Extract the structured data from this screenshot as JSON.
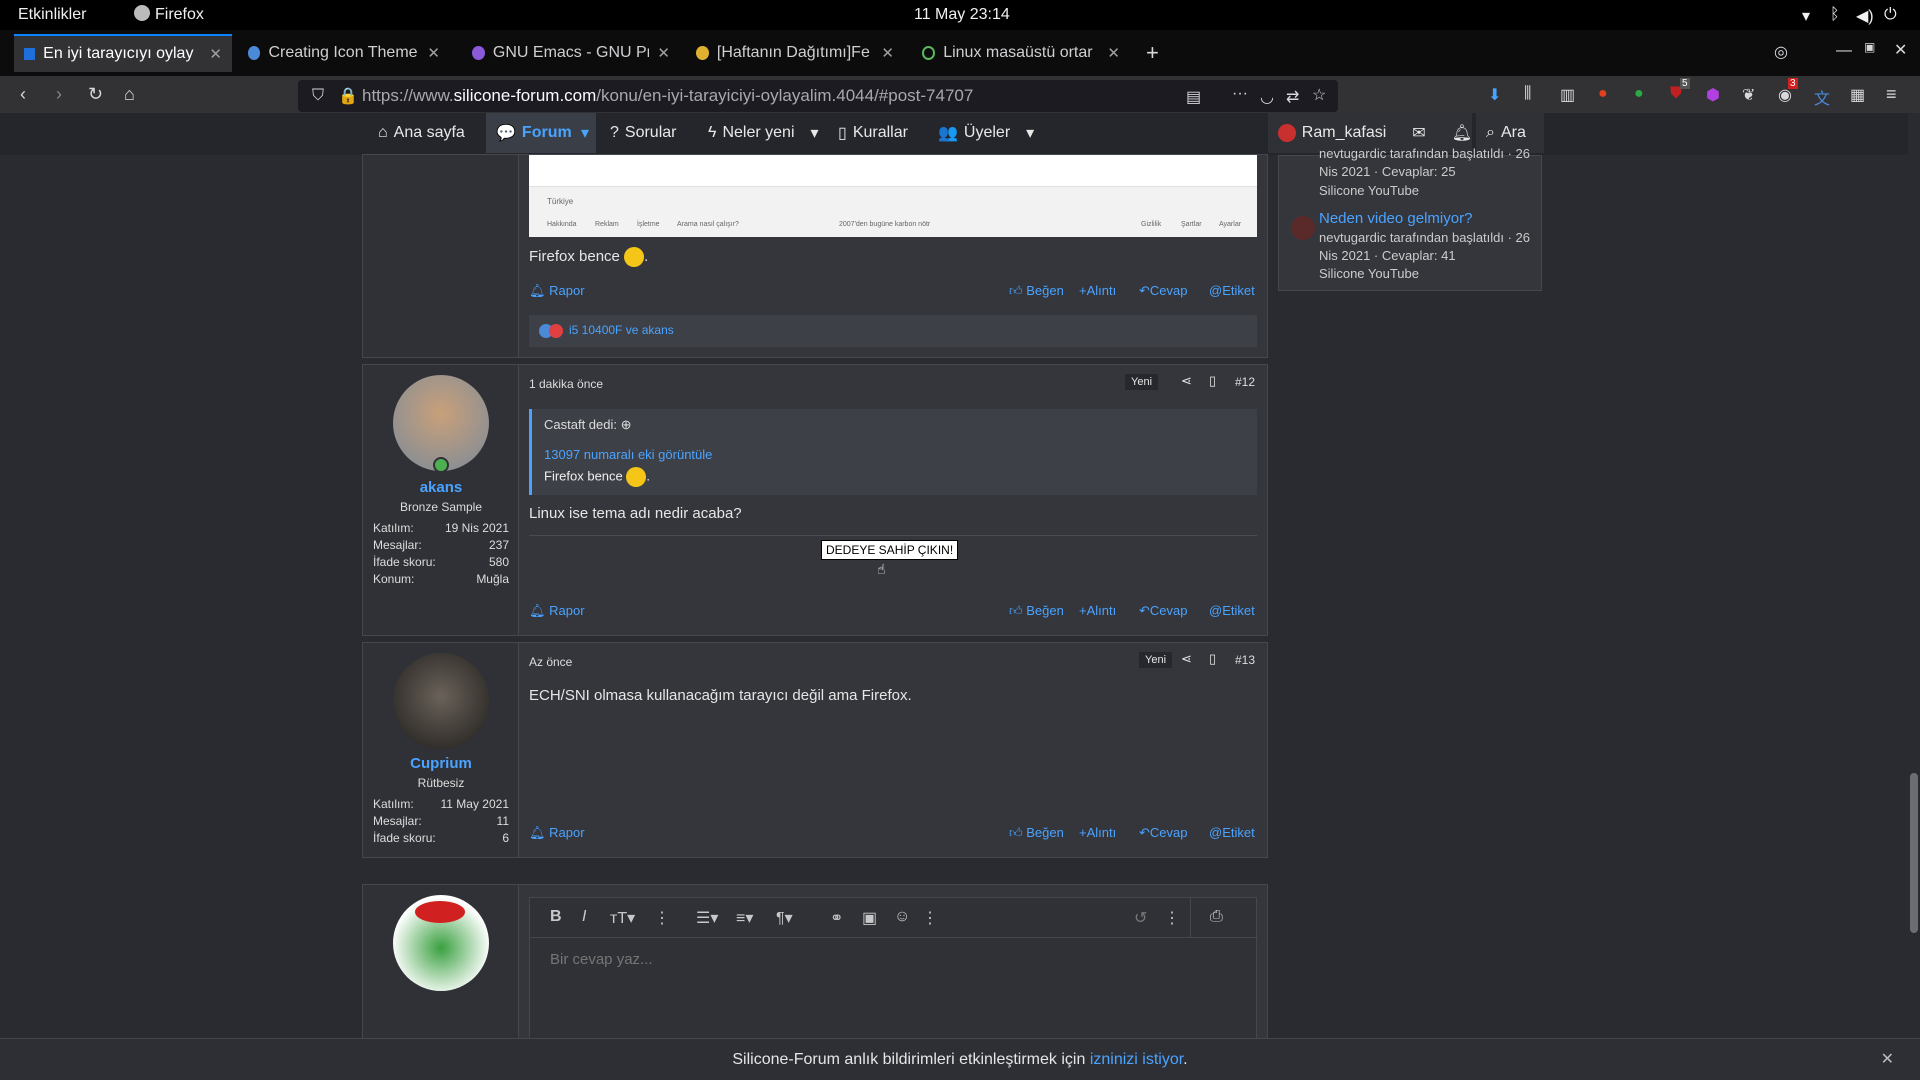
{
  "gnome": {
    "activities": "Etkinlikler",
    "app": "Firefox",
    "clock": "11 May 23:14"
  },
  "tabs": [
    {
      "title": "En iyi tarayıcıyı oylay"
    },
    {
      "title": "Creating Icon Theme"
    },
    {
      "title": "GNU Emacs - GNU Pr"
    },
    {
      "title": "[Haftanın Dağıtımı]Fe"
    },
    {
      "title": "Linux masaüstü ortar"
    }
  ],
  "url": {
    "prefix": "https://www.",
    "host": "silicone-forum.com",
    "path": "/konu/en-iyi-tarayiciyi-oylayalim.4044/#post-74707"
  },
  "toolbar_badges": {
    "b1": "5",
    "b2": "3"
  },
  "sitenav": {
    "home": "Ana sayfa",
    "forum": "Forum",
    "sorular": "Sorular",
    "neler": "Neler yeni",
    "kurallar": "Kurallar",
    "uyeler": "Üyeler",
    "user": "Ram_kafasi",
    "search": "Ara"
  },
  "sidebar": {
    "top_text": "nevtugardic tarafından başlatıldı · 26",
    "top_date": "Nis 2021 · Cevaplar: 25",
    "top_forum": "Silicone YouTube",
    "thread_title": "Neden video gelmiyor?",
    "thread_meta": "nevtugardic tarafından başlatıldı · 26",
    "thread_date": "Nis 2021 · Cevaplar: 41",
    "thread_forum": "Silicone YouTube"
  },
  "post11": {
    "screenshot_footer": [
      "Hakkında",
      "Reklam",
      "İşletme",
      "Arama nasıl çalışır?",
      "2007'den bugüne karbon nötr",
      "Gizlilik",
      "Şartlar",
      "Ayarlar"
    ],
    "screenshot_country": "Türkiye",
    "text": "Firefox bence",
    "report": "Rapor",
    "like": "Beğen",
    "quote": "Alıntı",
    "reply": "Cevap",
    "tag": "Etiket",
    "reactions": "i5 10400F ve akans"
  },
  "post12": {
    "time": "1 dakika önce",
    "new": "Yeni",
    "num": "#12",
    "user": "akans",
    "rank": "Bronze Sample",
    "join_label": "Katılım:",
    "join": "19 Nis 2021",
    "msg_label": "Mesajlar:",
    "msg": "237",
    "score_label": "İfade skoru:",
    "score": "580",
    "loc_label": "Konum:",
    "loc": "Muğla",
    "quote_author": "Castaft dedi:",
    "quote_link": "13097 numaralı eki görüntüle",
    "quote_text": "Firefox bence",
    "text": "Linux ise tema adı nedir acaba?",
    "sig": "DEDEYE SAHİP ÇIKIN!",
    "report": "Rapor",
    "like": "Beğen",
    "quote": "Alıntı",
    "reply": "Cevap",
    "tag": "Etiket"
  },
  "post13": {
    "time": "Az önce",
    "new": "Yeni",
    "num": "#13",
    "user": "Cuprium",
    "rank": "Rütbesiz",
    "join_label": "Katılım:",
    "join": "11 May 2021",
    "msg_label": "Mesajlar:",
    "msg": "11",
    "score_label": "İfade skoru:",
    "score": "6",
    "text": "ECH/SNI olmasa kullanacağım tarayıcı değil ama Firefox.",
    "report": "Rapor",
    "like": "Beğen",
    "quote": "Alıntı",
    "reply": "Cevap",
    "tag": "Etiket"
  },
  "editor": {
    "placeholder": "Bir cevap yaz..."
  },
  "notif": {
    "text": "Silicone-Forum anlık bildirimleri etkinleştirmek için ",
    "link": "izninizi istiyor",
    "end": "."
  }
}
